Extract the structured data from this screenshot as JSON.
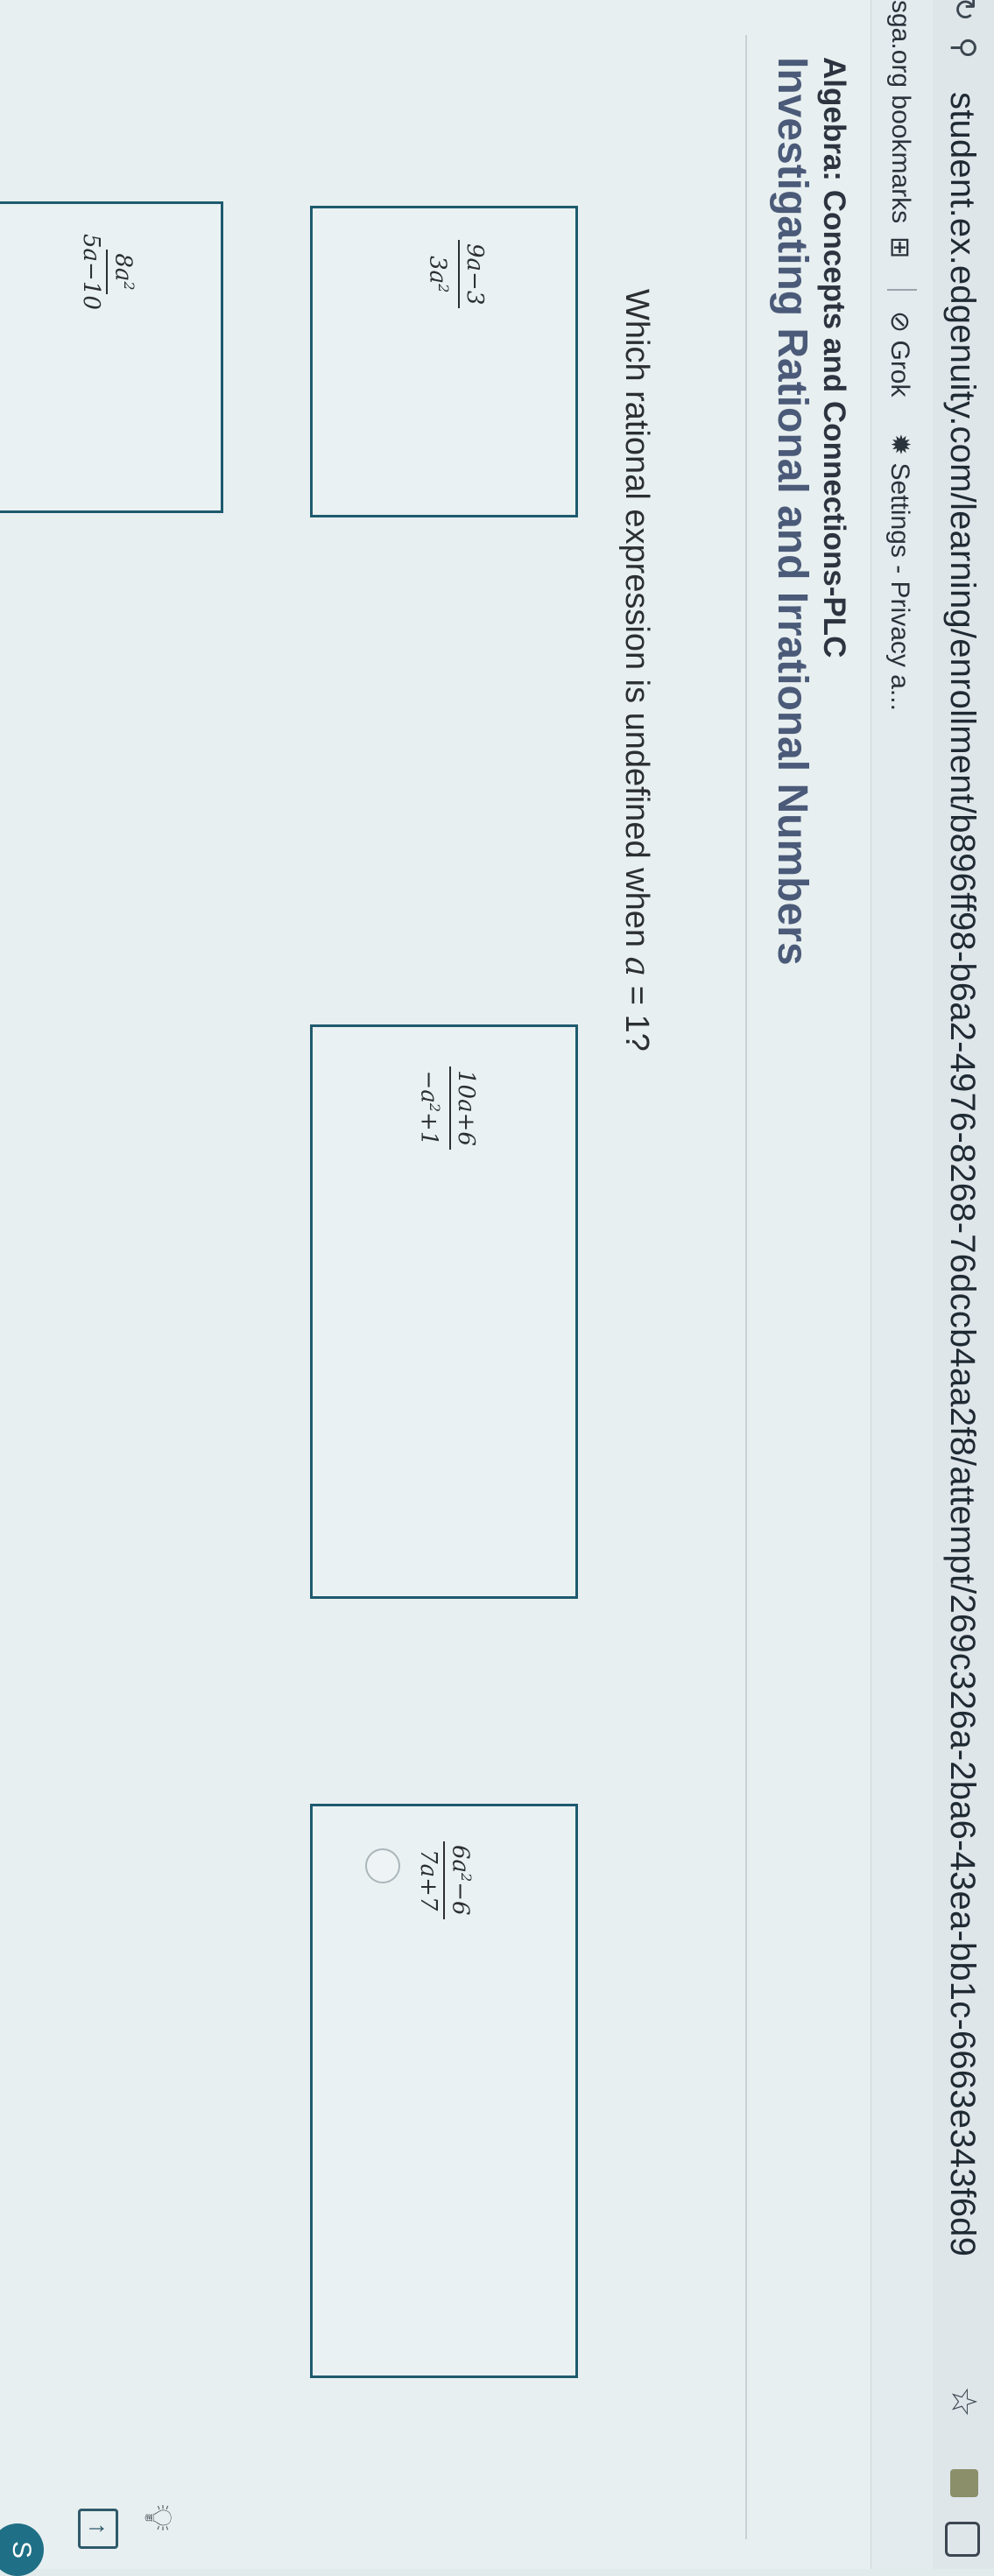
{
  "browser": {
    "url": "student.ex.edgenuity.com/learning/enrollment/b896ff98-b6a2-4976-8268-76dccb4aa2f8/attempt/269c326a-2ba6-43ea-bb1c-6663e343f6d9",
    "bookmarks": [
      "sga.org bookmarks",
      "Grok",
      "Settings - Privacy a..."
    ]
  },
  "course_title": "Algebra: Concepts and Connections-PLC",
  "lesson_title": "Investigating Rational and Irrational Numbers",
  "question": {
    "prefix": "Which rational expression is undefined when ",
    "variable": "a",
    "suffix": " = 1?"
  },
  "options": [
    {
      "num_text": "9a−3",
      "den_text": "3a",
      "den_sup": "2",
      "num_sup": ""
    },
    {
      "num_text": "8a",
      "num_sup": "2",
      "den_text": "5a−10",
      "den_sup": ""
    },
    {
      "num_text": "10a+6",
      "num_sup": "",
      "den_text": "−a",
      "den_sup": "2",
      "den_tail": "+1"
    },
    {
      "num_text": "6a",
      "num_sup": "2",
      "num_tail": "−6",
      "den_text": "7a+7",
      "den_sup": ""
    }
  ],
  "corner_badge": "S",
  "icons": {
    "reload": "reload-icon",
    "home": "home-icon",
    "site_info": "site-info-icon",
    "star": "star-icon",
    "apps": "apps-grid-icon",
    "grok": "grok-icon",
    "settings": "settings-gear-icon",
    "hint": "lightbulb-icon",
    "upload": "arrow-up-icon"
  }
}
